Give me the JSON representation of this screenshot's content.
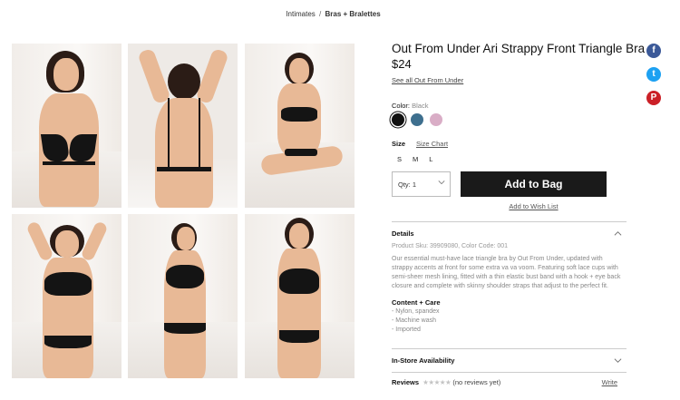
{
  "breadcrumb": {
    "parent": "Intimates",
    "separator": "/",
    "current": "Bras + Bralettes"
  },
  "gallery": {
    "images": [
      {
        "icon": "model-front-photo"
      },
      {
        "icon": "model-back-photo"
      },
      {
        "icon": "model-seated-photo"
      },
      {
        "icon": "model-front-full-photo"
      },
      {
        "icon": "model-side-photo"
      },
      {
        "icon": "model-standing-photo"
      }
    ]
  },
  "product": {
    "title": "Out From Under Ari Strappy Front Triangle Bra",
    "price": "$24",
    "brand_link": "See all Out From Under",
    "color_label": "Color:",
    "color_value": "Black",
    "colors": [
      {
        "name": "Black",
        "hex": "#111111",
        "selected": true
      },
      {
        "name": "Blue",
        "hex": "#3e6f8e",
        "selected": false
      },
      {
        "name": "Pink",
        "hex": "#d9adc6",
        "selected": false
      }
    ],
    "size_label": "Size",
    "size_chart": "Size Chart",
    "sizes": [
      "S",
      "M",
      "L"
    ],
    "qty_label": "Qty:",
    "qty_value": "1",
    "add_button": "Add to Bag",
    "wishlist": "Add to Wish List"
  },
  "details": {
    "heading": "Details",
    "sku": "Product Sku: 39909080, Color Code: 001",
    "description": "Our essential must-have lace triangle bra by Out From Under, updated with strappy accents at front for some extra va va voom. Featuring soft lace cups with semi-sheer mesh lining, fitted with a thin elastic bust band with a hook + eye back closure and complete with skinny shoulder straps that adjust to the perfect fit.",
    "care_heading": "Content + Care",
    "care_items": [
      "- Nylon, spandex",
      "- Machine wash",
      "- Imported"
    ]
  },
  "in_store": {
    "heading": "In-Store Availability"
  },
  "reviews": {
    "label": "Reviews",
    "stars": "★★★★★",
    "count_text": "(no reviews yet)",
    "write": "Write"
  },
  "social": {
    "facebook": {
      "glyph": "f",
      "color": "#3b5998"
    },
    "twitter": {
      "glyph": "t",
      "color": "#1da1f2"
    },
    "pinterest": {
      "glyph": "P",
      "color": "#cb2027"
    }
  }
}
